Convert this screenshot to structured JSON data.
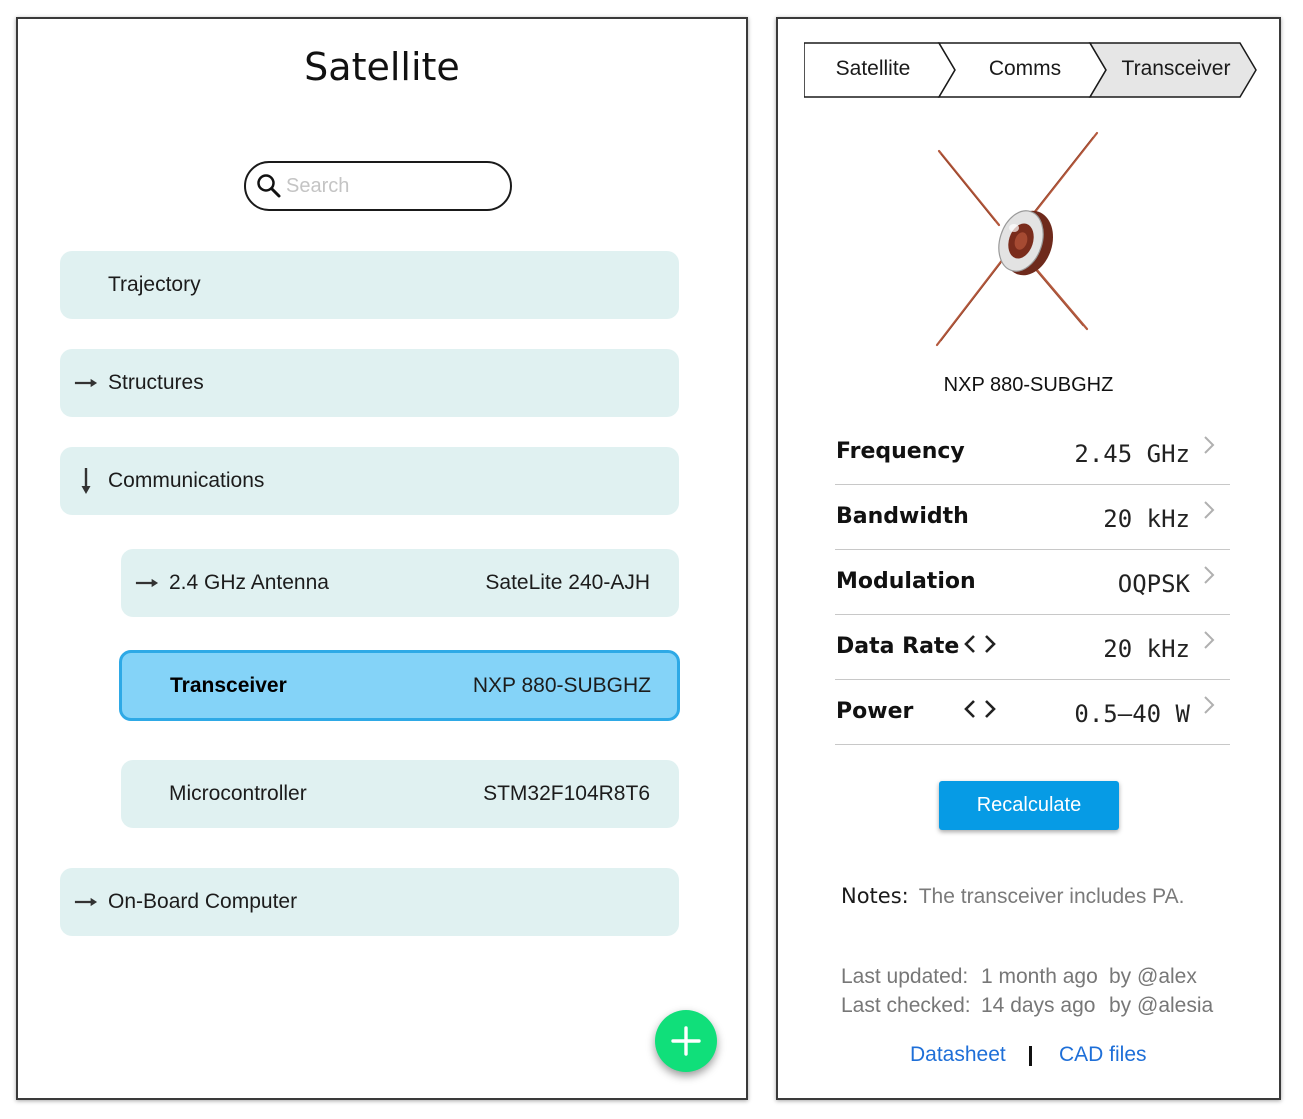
{
  "left": {
    "title": "Satellite",
    "search": {
      "placeholder": "Search",
      "value": ""
    },
    "items": [
      {
        "label": "Trajectory",
        "arrow": "none"
      },
      {
        "label": "Structures",
        "arrow": "right"
      },
      {
        "label": "Communications",
        "arrow": "down"
      },
      {
        "label": "2.4 GHz Antenna",
        "value": "SateLite 240-AJH",
        "arrow": "right"
      },
      {
        "label": "Transceiver",
        "value": "NXP 880-SUBGHZ",
        "arrow": "none",
        "selected": true
      },
      {
        "label": "Microcontroller",
        "value": "STM32F104R8T6",
        "arrow": "none"
      },
      {
        "label": "On-Board Computer",
        "arrow": "right"
      }
    ],
    "fab_icon": "plus-icon"
  },
  "right": {
    "breadcrumb": [
      "Satellite",
      "Comms",
      "Transceiver"
    ],
    "part_name": "NXP 880-SUBGHZ",
    "specs": [
      {
        "label": "Frequency",
        "value": "2.45 GHz",
        "adjustable": false
      },
      {
        "label": "Bandwidth",
        "value": "20 kHz",
        "adjustable": false
      },
      {
        "label": "Modulation",
        "value": "OQPSK",
        "adjustable": false
      },
      {
        "label": "Data Rate",
        "value": "20 kHz",
        "adjustable": true
      },
      {
        "label": "Power",
        "value": "0.5–40 W",
        "adjustable": true
      }
    ],
    "recalculate_label": "Recalculate",
    "notes": {
      "label": "Notes:",
      "text": "The transceiver includes PA."
    },
    "last_updated": {
      "label": "Last updated:",
      "when": "1 month ago",
      "by": "by @alex"
    },
    "last_checked": {
      "label": "Last checked:",
      "when": "14 days ago",
      "by": "by @alesia"
    },
    "links": {
      "datasheet": "Datasheet",
      "cad": "CAD files"
    }
  },
  "colors": {
    "item_bg": "#e0f1f1",
    "selected_bg": "#84d3f8",
    "selected_border": "#2ea9e6",
    "fab": "#10df7a",
    "primary_button": "#069be5",
    "link": "#1e6fd8",
    "active_crumb": "#e6e6e6"
  }
}
